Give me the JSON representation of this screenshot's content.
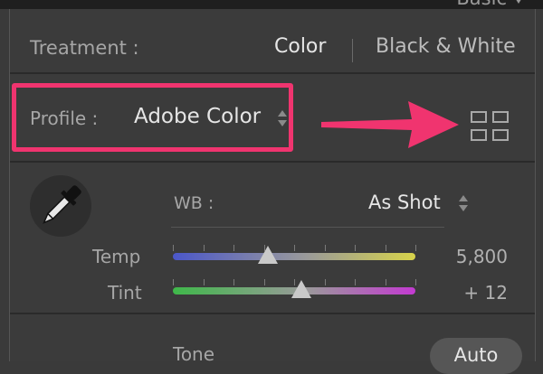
{
  "header": {
    "title": "Basic"
  },
  "treatment": {
    "label": "Treatment :",
    "options": [
      "Color",
      "Black & White"
    ],
    "selected": "Color"
  },
  "profile": {
    "label": "Profile :",
    "value": "Adobe Color"
  },
  "wb": {
    "label": "WB :",
    "value": "As Shot"
  },
  "sliders": {
    "temp": {
      "label": "Temp",
      "value": "5,800",
      "position": 0.39
    },
    "tint": {
      "label": "Tint",
      "value": "+ 12",
      "position": 0.53
    }
  },
  "tone": {
    "label": "Tone",
    "auto_label": "Auto"
  },
  "colors": {
    "highlight": "#f0346f",
    "panel": "#3b3b3b",
    "text_bright": "#e6e6e6",
    "text_dim": "#a6a6a6"
  },
  "icons": {
    "eyedropper": "eyedropper-icon",
    "profile_browser": "grid-icon",
    "annotation": "arrow-icon"
  }
}
